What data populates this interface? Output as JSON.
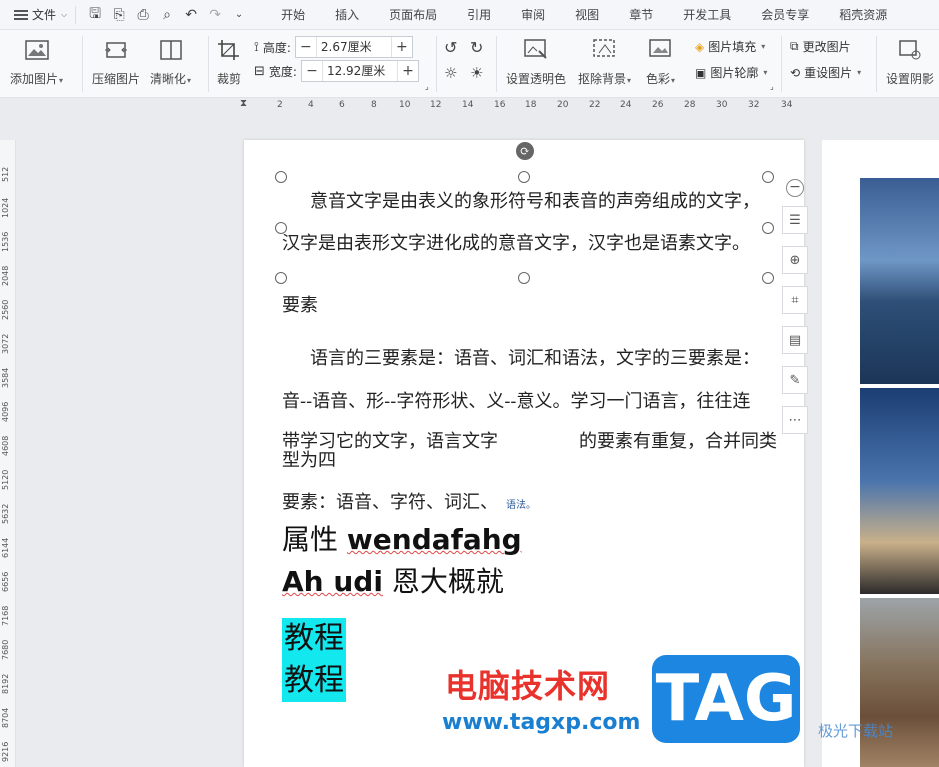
{
  "menubar": {
    "file_label": "文件",
    "tabs": [
      "开始",
      "插入",
      "页面布局",
      "引用",
      "审阅",
      "视图",
      "章节",
      "开发工具",
      "会员专享",
      "稻壳资源"
    ]
  },
  "ribbon": {
    "add_image": "添加图片",
    "compress": "压缩图片",
    "clarify": "清晰化",
    "crop": "裁剪",
    "height_label": "高度:",
    "height_value": "2.67厘米",
    "width_label": "宽度:",
    "width_value": "12.92厘米",
    "set_transparent": "设置透明色",
    "remove_bg": "抠除背景",
    "color": "色彩",
    "fill": "图片填充",
    "outline": "图片轮廓",
    "change_image": "更改图片",
    "reset_image": "重设图片",
    "set_shadow": "设置阴影"
  },
  "ruler": {
    "h_ticks": [
      "2",
      "4",
      "6",
      "8",
      "10",
      "12",
      "14",
      "16",
      "18",
      "20",
      "22",
      "24",
      "26",
      "28",
      "30",
      "32",
      "34"
    ],
    "v_ticks": [
      "512",
      "1024",
      "1536",
      "2048",
      "2560",
      "3072",
      "3584",
      "4096",
      "4608",
      "5120",
      "5632",
      "6144",
      "6656",
      "7168",
      "7680",
      "8192",
      "8704",
      "9216"
    ]
  },
  "document": {
    "p1_line1": "意音文字是由表义的象形符号和表音的声旁组成的文字，",
    "p1_line2": "汉字是由表形文字进化成的意音文字，汉字也是语素文字。",
    "heading": "要素",
    "p2_line1": "语言的三要素是：语音、词汇和语法，文字的三要素是：",
    "p2_line2": "音--语音、形--字符形状、义--意义。学习一门语言，往往连",
    "p2_line3a": "带学习它的文字，语言文字",
    "p2_line3b": "的要素有重复，合并同类",
    "p2_line4": "型为四",
    "p2_line5": "要素：语音、字符、词汇、",
    "p2_small": "语法。",
    "big1_cn": "属性",
    "big1_en": "wendafahg",
    "big2_en": "Ah udi",
    "big2_cn": "恩大概就",
    "hl_line1": "教程",
    "hl_line2": "教程"
  },
  "watermark": {
    "title": "电脑技术网",
    "url": "www.tagxp.com",
    "logo": "TAG",
    "site2": "极光下载站"
  }
}
